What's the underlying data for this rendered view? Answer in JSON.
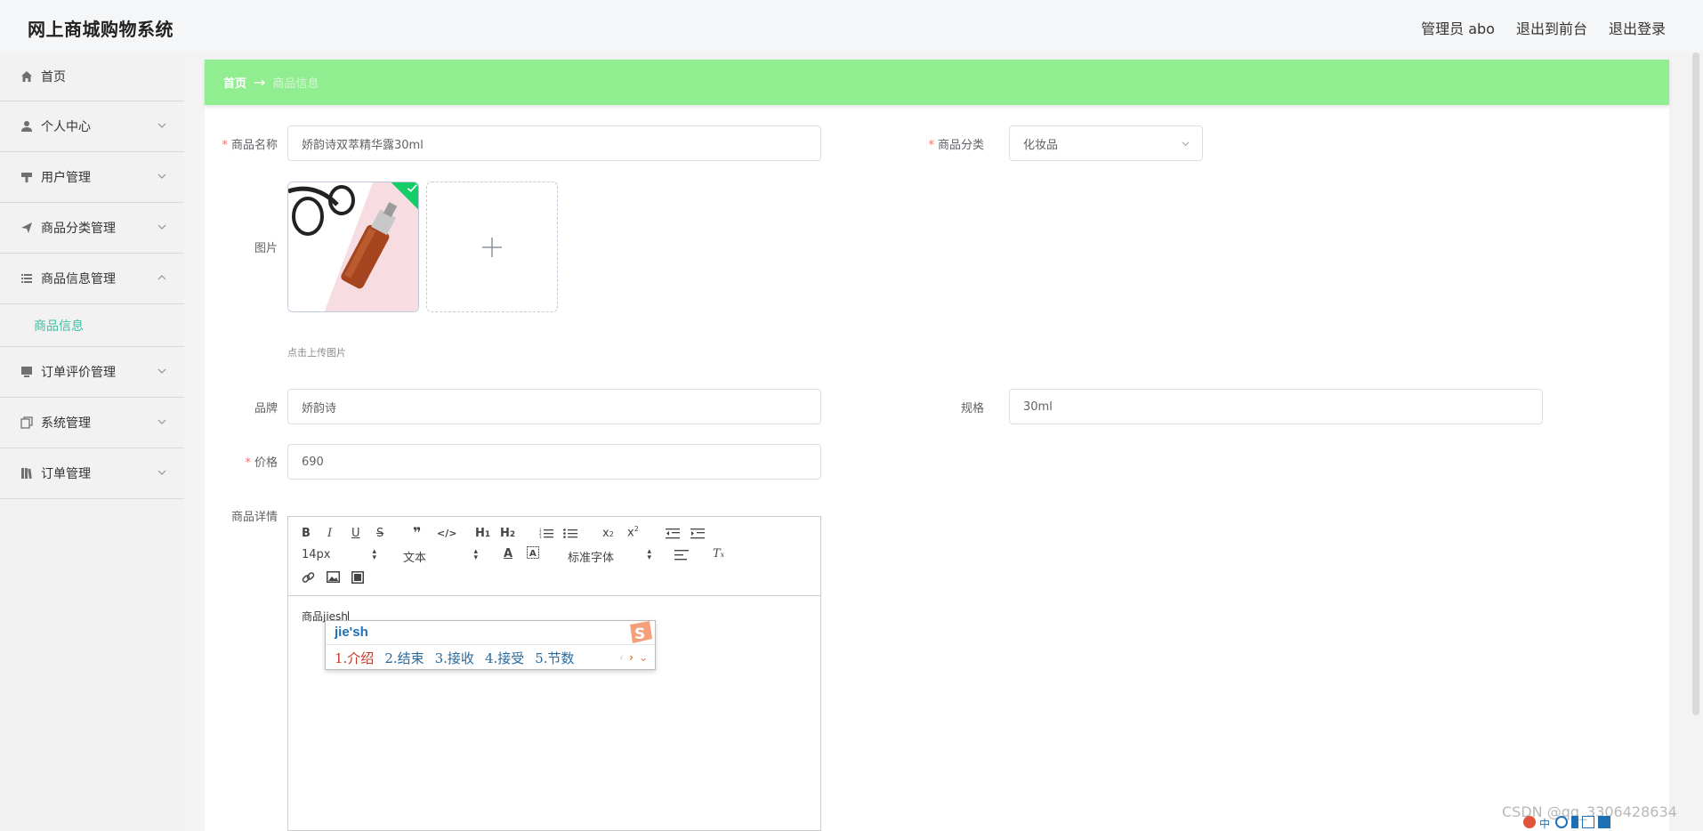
{
  "app": {
    "title": "网上商城购物系统"
  },
  "topnav": {
    "user": "管理员 abo",
    "to_front": "退出到前台",
    "logout": "退出登录"
  },
  "sidebar": {
    "items": [
      {
        "label": "首页",
        "icon": "home-icon"
      },
      {
        "label": "个人中心",
        "icon": "user-icon"
      },
      {
        "label": "用户管理",
        "icon": "hammer-icon"
      },
      {
        "label": "商品分类管理",
        "icon": "paper-plane-icon"
      },
      {
        "label": "商品信息管理",
        "icon": "list-icon",
        "expanded": true,
        "sub": [
          "商品信息"
        ]
      },
      {
        "label": "订单评价管理",
        "icon": "monitor-icon"
      },
      {
        "label": "系统管理",
        "icon": "copy-icon"
      },
      {
        "label": "订单管理",
        "icon": "book-icon"
      }
    ]
  },
  "breadcrumb": {
    "home": "首页",
    "arrow": "→",
    "current": "商品信息"
  },
  "form": {
    "name": {
      "label": "商品名称",
      "value": "娇韵诗双萃精华露30ml"
    },
    "category": {
      "label": "商品分类",
      "value": "化妆品"
    },
    "image": {
      "label": "图片",
      "tip": "点击上传图片"
    },
    "brand": {
      "label": "品牌",
      "value": "娇韵诗"
    },
    "spec": {
      "label": "规格",
      "value": "30ml"
    },
    "price": {
      "label": "价格",
      "value": "690"
    },
    "detail": {
      "label": "商品详情",
      "content": "商品jiesh"
    }
  },
  "editor": {
    "font_size": "14px",
    "header_select": "文本",
    "font_family": "标准字体",
    "toolbar_icons": [
      "bold-icon",
      "italic-icon",
      "underline-icon",
      "strikethrough-icon",
      "blockquote-icon",
      "code-icon",
      "h1-icon",
      "h2-icon",
      "ordered-list-icon",
      "bullet-list-icon",
      "subscript-icon",
      "superscript-icon",
      "outdent-icon",
      "indent-icon",
      "font-color-icon",
      "background-color-icon",
      "align-icon",
      "clear-format-icon",
      "link-icon",
      "image-icon",
      "video-icon"
    ]
  },
  "ime": {
    "composition": "jie'sh",
    "candidates": [
      "1.介绍",
      "2.结束",
      "3.接收",
      "4.接受",
      "5.节数"
    ]
  },
  "watermark": "CSDN @qq_3306428634",
  "colors": {
    "breadcrumb_bg": "#90ee90",
    "accent": "#3fbfa2",
    "required": "#f56c6c",
    "upload_check": "#13ce66"
  }
}
